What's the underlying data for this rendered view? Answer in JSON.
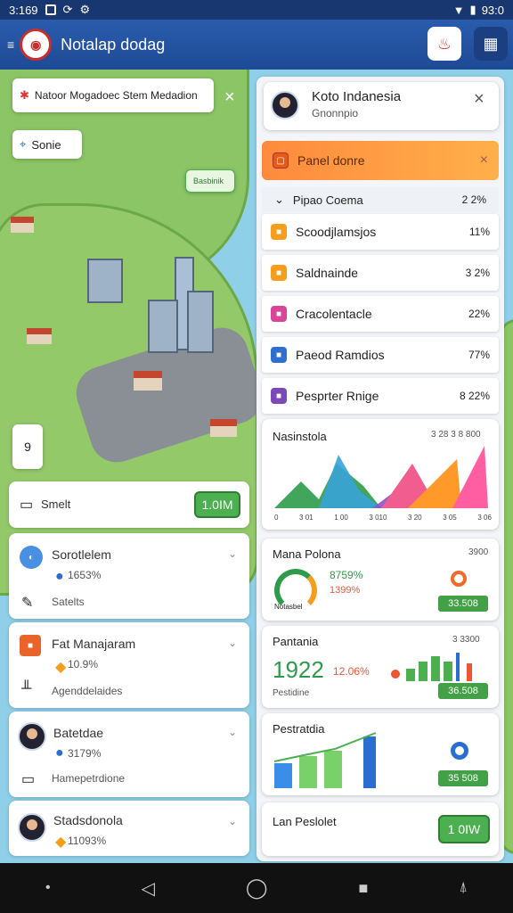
{
  "status": {
    "time": "3:169",
    "battery": "93:0"
  },
  "appbar": {
    "title": "Notalap dodag"
  },
  "map": {
    "info_chip": "Natoor Mogadoec Stem Medadion",
    "search_chip": "Sonie",
    "place_label": "Basbinik",
    "zoom_label": "9"
  },
  "panel": {
    "title": "Koto Indanesia",
    "subtitle": "Gnonnpio",
    "banner": "Panel donre",
    "section": "Pipao Coema",
    "section_pct": "2 2%",
    "rows": [
      {
        "label": "Scoodjlamsjos",
        "pct": "11%",
        "color": "#f59e1b"
      },
      {
        "label": "Saldnainde",
        "pct": "3 2%",
        "color": "#f59e1b"
      },
      {
        "label": "Cracolentacle",
        "pct": "22%",
        "color": "#d8459a"
      },
      {
        "label": "Paeod Ramdios",
        "pct": "77%",
        "color": "#2f6fd0"
      },
      {
        "label": "Pesprter Rnige",
        "pct": "8 22%",
        "color": "#7b4ab8"
      }
    ]
  },
  "area_chart": {
    "title": "Nasinstola",
    "legend": "3 28 3 8 800",
    "ticks": [
      "0",
      "3 01",
      "1 00",
      "3 010",
      "3 20",
      "3 05",
      "3 06"
    ]
  },
  "gauge_card": {
    "title": "Mana Polona",
    "value": "3900",
    "pct": "8759%",
    "sub": "1399%",
    "gauge_label": "Notasbel",
    "button": "33.508"
  },
  "big_card": {
    "title": "Pantania",
    "value": "3 3300",
    "big": "1922",
    "pct": "12.06%",
    "sub": "Pestidine",
    "button": "36.508"
  },
  "growth_card": {
    "title": "Pestratdia",
    "button": "35 508"
  },
  "last_card": {
    "title": "Lan Peslolet",
    "button": "1 0IW"
  },
  "left_list": {
    "search_label": "Smelt",
    "search_button": "1.0IM",
    "items": [
      {
        "title": "Sorotlelem",
        "pct": "1653%",
        "sub": "Satelts",
        "ic": "#4a90e2"
      },
      {
        "title": "Fat Manajaram",
        "pct": "10.9%",
        "sub": "Agenddelaides",
        "ic": "#e8642a"
      },
      {
        "title": "Batetdae",
        "pct": "3179%",
        "sub": "Hamepetrdione"
      },
      {
        "title": "Stadsdonola",
        "pct": "11093%",
        "sub": ""
      }
    ]
  }
}
